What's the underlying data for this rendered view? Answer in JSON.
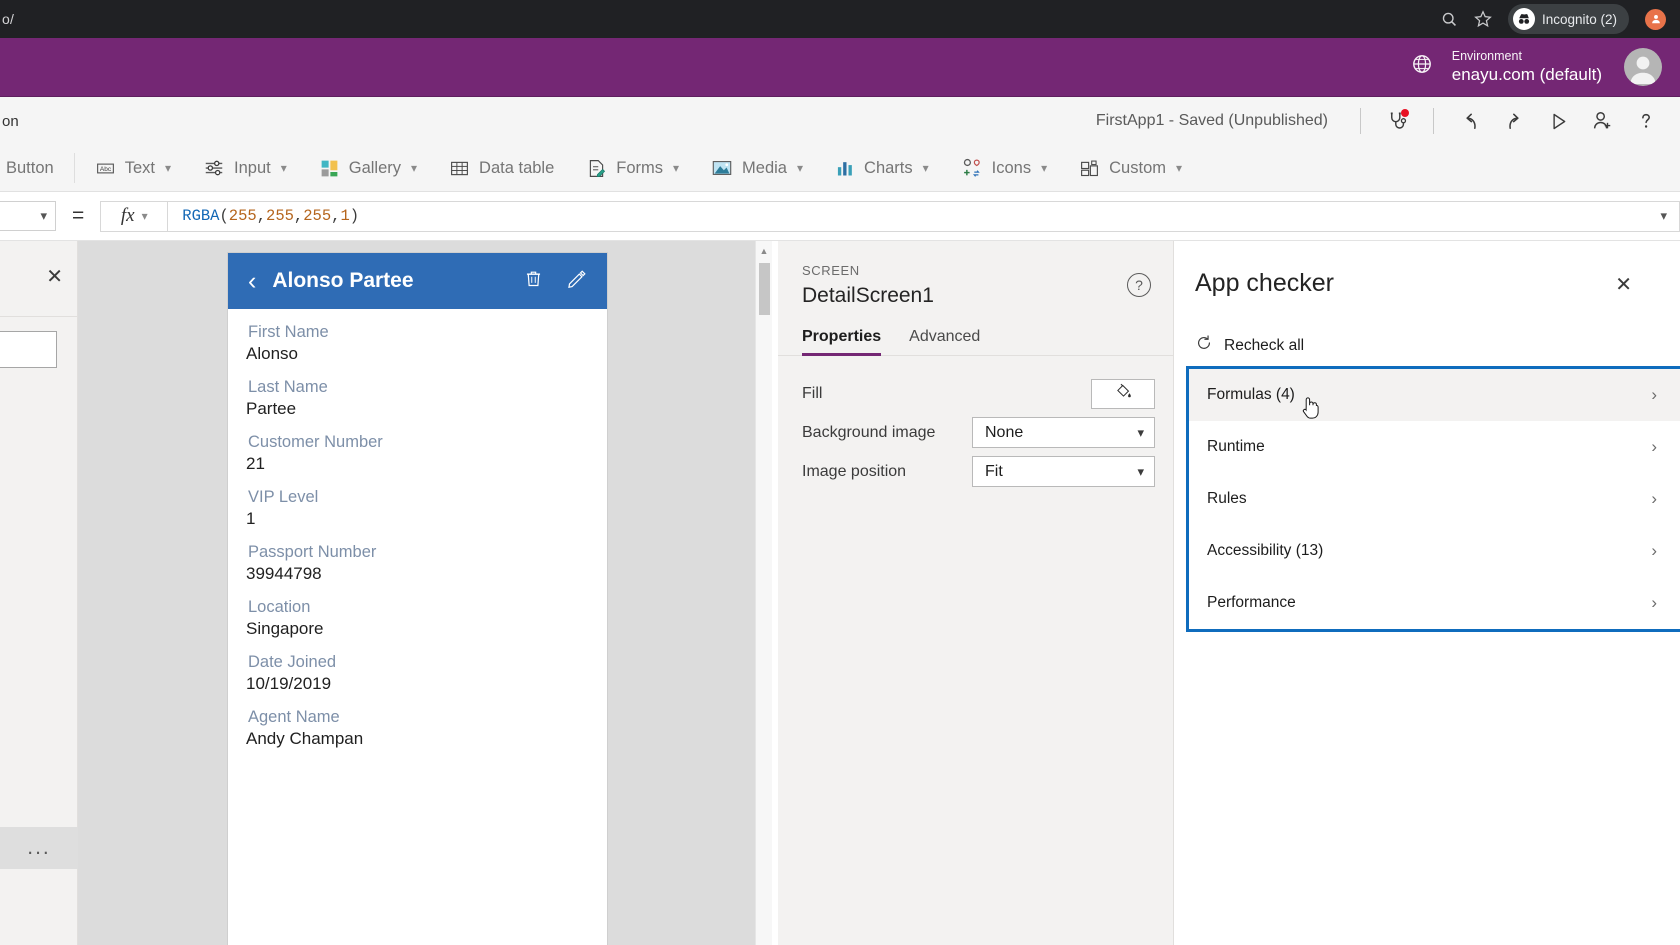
{
  "browser": {
    "url_fragment": "o/",
    "zoom_icon": "zoom-search-icon",
    "star_icon": "bookmark-star-icon",
    "incognito_label": "Incognito (2)",
    "profile_icon": "profile-avatar-icon"
  },
  "env_header": {
    "globe_icon": "globe-environment-icon",
    "label": "Environment",
    "name": "enayu.com (default)",
    "avatar_icon": "user-avatar-icon",
    "bg_color": "#742774"
  },
  "command_bar": {
    "left_fragment": "on",
    "save_status": "FirstApp1 - Saved (Unpublished)",
    "app_checker_icon": "stethoscope-icon",
    "app_checker_badge_color": "#e81123",
    "undo_icon": "undo-arrow-icon",
    "redo_icon": "redo-arrow-icon",
    "preview_icon": "play-triangle-icon",
    "share_icon": "person-add-icon",
    "help_icon": "question-mark-icon"
  },
  "insert_toolbar": {
    "items": [
      {
        "label": "Button",
        "icon": "button-icon",
        "has_caret": false
      },
      {
        "label": "Text",
        "icon": "text-abc-icon",
        "has_caret": true
      },
      {
        "label": "Input",
        "icon": "sliders-input-icon",
        "has_caret": true
      },
      {
        "label": "Gallery",
        "icon": "gallery-grid-icon",
        "has_caret": true
      },
      {
        "label": "Data table",
        "icon": "data-table-icon",
        "has_caret": false
      },
      {
        "label": "Forms",
        "icon": "forms-edit-icon",
        "has_caret": true
      },
      {
        "label": "Media",
        "icon": "media-image-icon",
        "has_caret": true
      },
      {
        "label": "Charts",
        "icon": "charts-bar-icon",
        "has_caret": true
      },
      {
        "label": "Icons",
        "icon": "icons-shapes-icon",
        "has_caret": true
      },
      {
        "label": "Custom",
        "icon": "custom-component-icon",
        "has_caret": true
      }
    ]
  },
  "formula_bar": {
    "property_caret": "chevron-down-icon",
    "equals": "=",
    "fx_label": "fx",
    "fx_caret": "chevron-down-icon",
    "formula_tokens": [
      {
        "text": "RGBA",
        "type": "fn"
      },
      {
        "text": "(",
        "type": "paren"
      },
      {
        "text": "255",
        "type": "num"
      },
      {
        "text": ", ",
        "type": "paren"
      },
      {
        "text": "255",
        "type": "num"
      },
      {
        "text": ", ",
        "type": "paren"
      },
      {
        "text": "255",
        "type": "num"
      },
      {
        "text": ", ",
        "type": "paren"
      },
      {
        "text": "1",
        "type": "num"
      },
      {
        "text": ")",
        "type": "paren"
      }
    ],
    "expand_caret": "chevron-down-icon"
  },
  "left_panel": {
    "close_icon": "close-x-icon",
    "search_value": "",
    "ellipsis_label": "..."
  },
  "canvas": {
    "phone": {
      "header": {
        "back_icon": "chevron-left-icon",
        "title": "Alonso Partee",
        "delete_icon": "trash-can-icon",
        "edit_icon": "pencil-edit-icon",
        "bg_color": "#2f6cb5"
      },
      "fields": [
        {
          "label": "First Name",
          "value": "Alonso"
        },
        {
          "label": "Last Name",
          "value": "Partee"
        },
        {
          "label": "Customer Number",
          "value": "21"
        },
        {
          "label": "VIP Level",
          "value": "1"
        },
        {
          "label": "Passport Number",
          "value": "39944798"
        },
        {
          "label": "Location",
          "value": "Singapore"
        },
        {
          "label": "Date Joined",
          "value": "10/19/2019"
        },
        {
          "label": "Agent Name",
          "value": "Andy Champan"
        }
      ]
    },
    "scrollbar": {
      "up_arrow": "triangle-up-icon"
    }
  },
  "properties": {
    "kind": "SCREEN",
    "name": "DetailScreen1",
    "help_icon": "question-circle-icon",
    "tabs": [
      {
        "label": "Properties",
        "active": true
      },
      {
        "label": "Advanced",
        "active": false
      }
    ],
    "rows": [
      {
        "label": "Fill",
        "control": "color",
        "icon": "paint-bucket-icon"
      },
      {
        "label": "Background image",
        "control": "dropdown",
        "value": "None"
      },
      {
        "label": "Image position",
        "control": "dropdown",
        "value": "Fit"
      }
    ],
    "accent_color": "#742774"
  },
  "app_checker": {
    "title": "App checker",
    "close_icon": "close-x-icon",
    "recheck_label": "Recheck all",
    "recheck_icon": "refresh-circle-icon",
    "focus_border_color": "#0f6cbd",
    "items": [
      {
        "label": "Formulas (4)",
        "hovered": true
      },
      {
        "label": "Runtime",
        "hovered": false
      },
      {
        "label": "Rules",
        "hovered": false
      },
      {
        "label": "Accessibility (13)",
        "hovered": false
      },
      {
        "label": "Performance",
        "hovered": false
      }
    ]
  }
}
